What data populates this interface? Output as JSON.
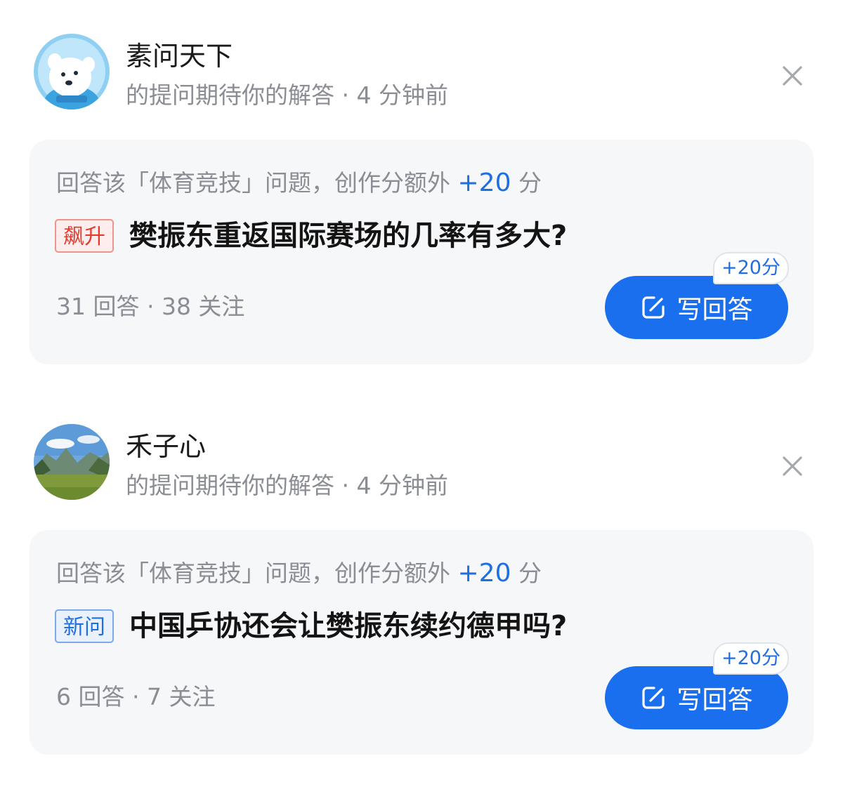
{
  "feed": [
    {
      "asker": {
        "name": "素问天下",
        "avatar": "polar-bear-avatar"
      },
      "subtitle": "的提问期待你的解答 · 4 分钟前",
      "hint": {
        "prefix": "回答该「体育竞技」问题，创作分额外 ",
        "bonus": "+20",
        "suffix": " 分"
      },
      "tag": "飙升",
      "tag_color": "#e23a2e",
      "question": "樊振东重返国际赛场的几率有多大?",
      "stats": "31 回答 · 38 关注",
      "answer_label": "写回答",
      "bonus_badge": "+20分"
    },
    {
      "asker": {
        "name": "禾子心",
        "avatar": "landscape-avatar"
      },
      "subtitle": "的提问期待你的解答 · 4 分钟前",
      "hint": {
        "prefix": "回答该「体育竞技」问题，创作分额外 ",
        "bonus": "+20",
        "suffix": " 分"
      },
      "tag": "新问",
      "tag_color": "#1f6fe0",
      "question": "中国乒协还会让樊振东续约德甲吗?",
      "stats": "6 回答 · 7 关注",
      "answer_label": "写回答",
      "bonus_badge": "+20分"
    }
  ],
  "colors": {
    "accent": "#1a6fee",
    "bonus_text": "#1f6fe0",
    "muted_text": "#8a8d93",
    "card_bg": "#f6f7f9"
  }
}
